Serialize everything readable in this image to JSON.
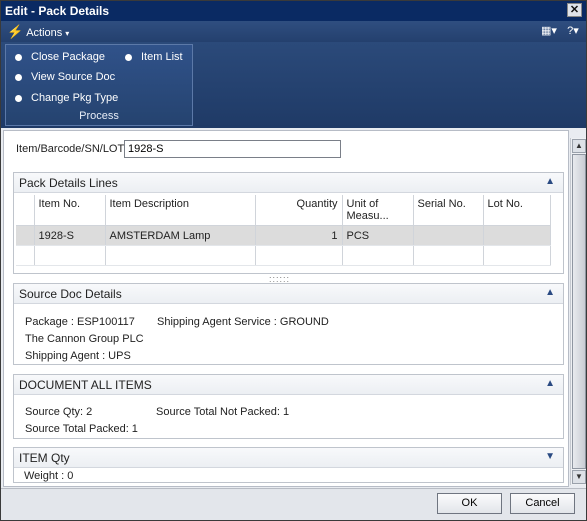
{
  "window": {
    "title": "Edit - Pack Details",
    "close_glyph": "✕"
  },
  "actions_bar": {
    "actions_label": "Actions",
    "caret": "▾",
    "view_glyph": "▦▾",
    "help_glyph": "?▾"
  },
  "ribbon": {
    "group_label": "Process",
    "items": [
      {
        "label": "Close Package",
        "icon": "dot-icon"
      },
      {
        "label": "View Source Doc",
        "icon": "dot-icon"
      },
      {
        "label": "Change Pkg Type",
        "icon": "dot-icon"
      },
      {
        "label": "Item List",
        "icon": "dot-icon"
      }
    ]
  },
  "search": {
    "label": "Item/Barcode/SN/LOT:",
    "value": "1928-S"
  },
  "pack_lines": {
    "title": "Pack Details Lines",
    "collapse_glyph": "▲",
    "columns": [
      "Item No.",
      "Item Description",
      "Quantity",
      "Unit of Measu...",
      "Serial No.",
      "Lot No."
    ],
    "rows": [
      {
        "item_no": "1928-S",
        "description": "AMSTERDAM Lamp",
        "quantity": "1",
        "unit": "PCS",
        "serial": "",
        "lot": ""
      }
    ],
    "grip": "::::::"
  },
  "source_doc": {
    "title": "Source Doc Details",
    "collapse_glyph": "▲",
    "package": "Package : ESP100117",
    "customer": "The Cannon Group PLC",
    "shipping_agent": "Shipping Agent : UPS",
    "shipping_service": "Shipping Agent Service : GROUND"
  },
  "doc_items": {
    "title": "DOCUMENT ALL ITEMS",
    "collapse_glyph": "▲",
    "source_qty": "Source Qty: 2",
    "source_total_packed": "Source Total Packed: 1",
    "source_not_packed": "Source Total Not Packed: 1"
  },
  "item_qty": {
    "title": "ITEM Qty",
    "expand_glyph": "▼",
    "weight": "Weight : 0"
  },
  "footer": {
    "ok_label": "OK",
    "cancel_label": "Cancel"
  },
  "colors": {
    "titlebar": "#0a2a63",
    "ribbon": "#24406e",
    "selected_row": "#dcdcdc"
  }
}
